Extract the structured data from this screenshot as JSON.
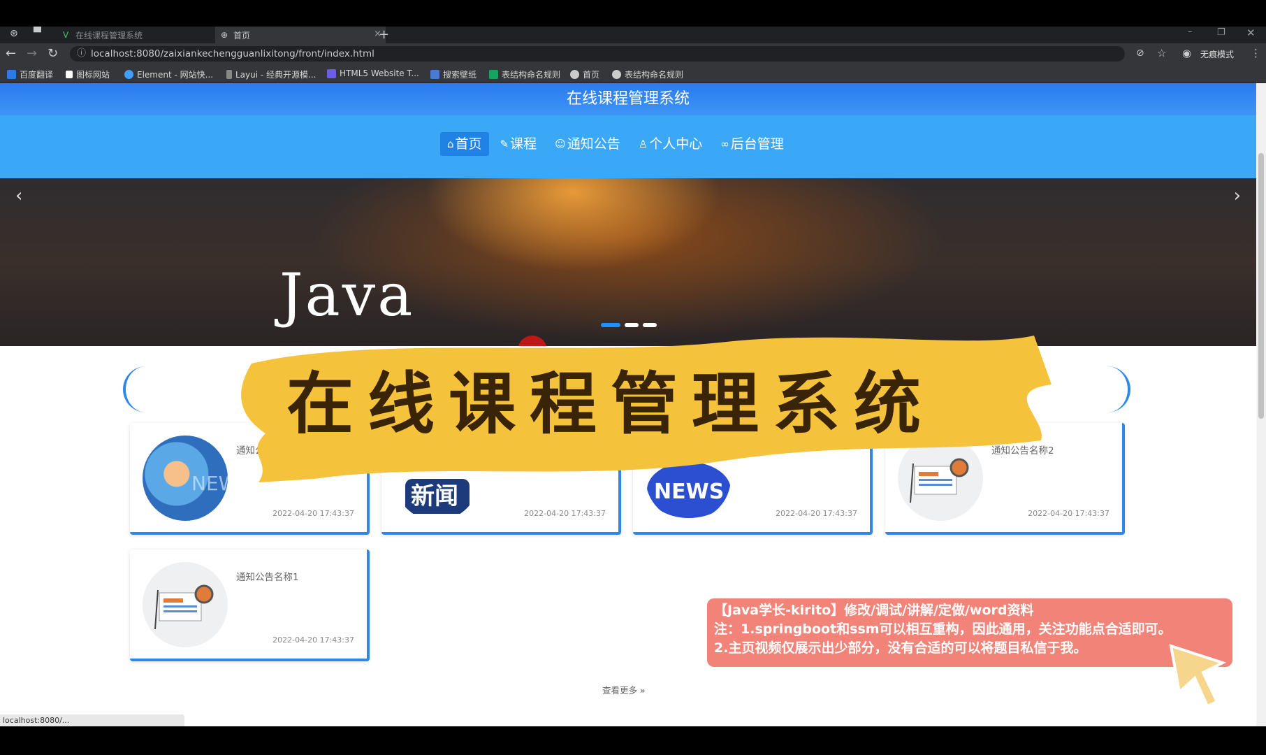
{
  "browser": {
    "tabs": [
      {
        "label": "在线课程管理系统",
        "active": false
      },
      {
        "label": "首页",
        "active": true
      }
    ],
    "url": "localhost:8080/zaixiankechengguanlixitong/front/index.html",
    "profile_label": "无痕模式",
    "bookmarks": [
      {
        "label": "百度翻译",
        "color": "#2c7be5"
      },
      {
        "label": "图标网站",
        "color": "#ffffff"
      },
      {
        "label": "Element - 网站快...",
        "color": "#409eff"
      },
      {
        "label": "Layui - 经典开源模...",
        "color": "#aaaaaa"
      },
      {
        "label": "HTML5 Website T...",
        "color": "#6c5ce7"
      },
      {
        "label": "搜索壁纸",
        "color": "#4a7bd0"
      },
      {
        "label": "表结构命名规则",
        "color": "#1aa260"
      },
      {
        "label": "首页",
        "color": "#cccccc"
      },
      {
        "label": "表结构命名规则",
        "color": "#cccccc"
      }
    ],
    "status_url": "localhost:8080/..."
  },
  "header": {
    "site_title": "在线课程管理系统",
    "nav": [
      {
        "label": "首页",
        "icon": "home-icon",
        "glyph": "⌂",
        "active": true
      },
      {
        "label": "课程",
        "icon": "course-icon",
        "glyph": "✎",
        "active": false
      },
      {
        "label": "通知公告",
        "icon": "notice-icon",
        "glyph": "☺",
        "active": false
      },
      {
        "label": "个人中心",
        "icon": "user-icon",
        "glyph": "♙",
        "active": false
      },
      {
        "label": "后台管理",
        "icon": "link-icon",
        "glyph": "∞",
        "active": false
      }
    ]
  },
  "banner": {
    "text": "Java",
    "slide_count": 3,
    "active_slide": 0
  },
  "notices": [
    {
      "name": "通知公",
      "time": "2022-04-20 17:43:37",
      "image": "globe-news-image"
    },
    {
      "name": "",
      "time": "2022-04-20 17:43:37",
      "image": "xinwen-image",
      "badge": "新闻"
    },
    {
      "name": "",
      "time": "2022-04-20 17:43:37",
      "image": "news-bubble-image",
      "badge": "NEWS"
    },
    {
      "name": "通知公告名称2",
      "time": "2022-04-20 17:43:37",
      "image": "newspaper-image"
    },
    {
      "name": "通知公告名称1",
      "time": "2022-04-20 17:43:37",
      "image": "newspaper-image"
    }
  ],
  "more_link": "查看更多",
  "overlay": {
    "headline": "在线课程管理系统",
    "headline_color": "#3a2408",
    "brush_color": "#f5c33b",
    "note_lines": [
      "【Java学长-kirito】修改/调试/讲解/定做/word资料",
      "注：1.springboot和ssm可以相互重构，因此通用，关注功能点合适即可。",
      "2.主页视频仅展示出少部分，没有合适的可以将题目私信于我。"
    ]
  }
}
